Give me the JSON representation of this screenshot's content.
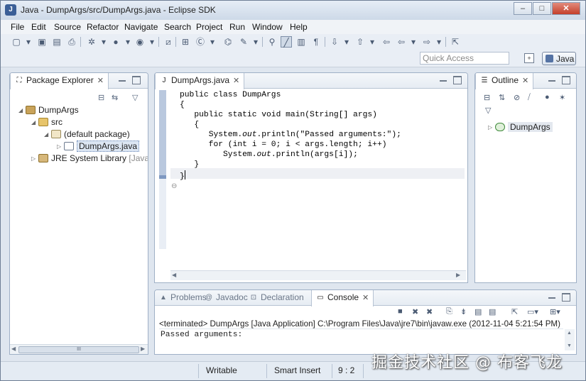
{
  "window": {
    "title": "Java - DumpArgs/src/DumpArgs.java - Eclipse SDK",
    "controls": [
      "–",
      "□",
      "✕"
    ]
  },
  "menubar": [
    "File",
    "Edit",
    "Source",
    "Refactor",
    "Navigate",
    "Search",
    "Project",
    "Run",
    "Window",
    "Help"
  ],
  "quickbar": {
    "quick_access_placeholder": "Quick Access",
    "perspective": "Java"
  },
  "package_explorer": {
    "tab_label": "Package Explorer",
    "tree": [
      {
        "label": "DumpArgs",
        "icon": "project-icon"
      },
      {
        "label": "src",
        "icon": "source-folder-icon"
      },
      {
        "label": "(default package)",
        "icon": "package-icon"
      },
      {
        "label": "DumpArgs.java",
        "icon": "java-file-icon"
      },
      {
        "label": "JRE System Library",
        "extra": "[JavaSE",
        "icon": "library-icon"
      }
    ],
    "scroll_thumb": "III"
  },
  "editor": {
    "tab_label": "DumpArgs.java",
    "lines": [
      "public class DumpArgs",
      "{",
      "   public static void main(String[] args)",
      "   {",
      "      System.",
      "      for (int i = 0; i < args.length; i++)",
      "         System.",
      "   }",
      "}"
    ],
    "println_pre": "System.",
    "out_token": "out",
    "println_args_1": ".println(\"Passed arguments:\");",
    "println_args_2": ".println(args[i]);"
  },
  "outline": {
    "tab_label": "Outline",
    "tree": [
      {
        "label": "DumpArgs"
      }
    ]
  },
  "bottom_panel": {
    "tabs": [
      "Problems",
      "Javadoc",
      "Declaration",
      "Console"
    ],
    "active_tab": "Console",
    "status_line": "<terminated> DumpArgs [Java Application] C:\\Program Files\\Java\\jre7\\bin\\javaw.exe (2012-11-04 5:21:54 PM)",
    "output": "Passed arguments:"
  },
  "statusbar": {
    "writable": "Writable",
    "insert_mode": "Smart Insert",
    "position": "9 : 2"
  },
  "watermark": "掘金技术社区 @ 布客飞龙"
}
